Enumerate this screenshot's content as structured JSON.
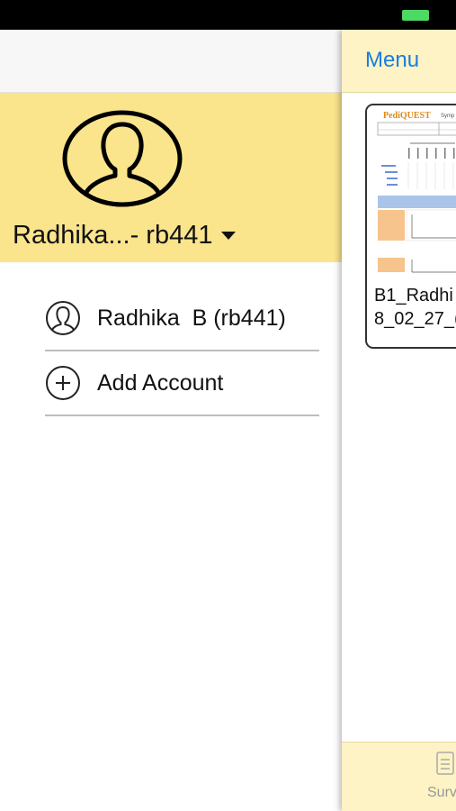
{
  "drawer": {
    "profile_name": "Radhika...- rb441",
    "accounts": [
      {
        "label": "Radhika  B (rb441)",
        "icon": "user-icon"
      },
      {
        "label": "Add Account",
        "icon": "plus-circle-icon"
      }
    ]
  },
  "main": {
    "menu_label": "Menu",
    "document": {
      "title": "B1_Radhi\n8_02_27_(",
      "thumbnail_brand": "PediQUEST",
      "thumbnail_subtitle": "Symp"
    },
    "tab_label": "Surv"
  },
  "colors": {
    "profile_bg": "#fae48c",
    "nav_bg": "#fdf3c4",
    "accent": "#1a7de0",
    "battery": "#4cd964"
  }
}
